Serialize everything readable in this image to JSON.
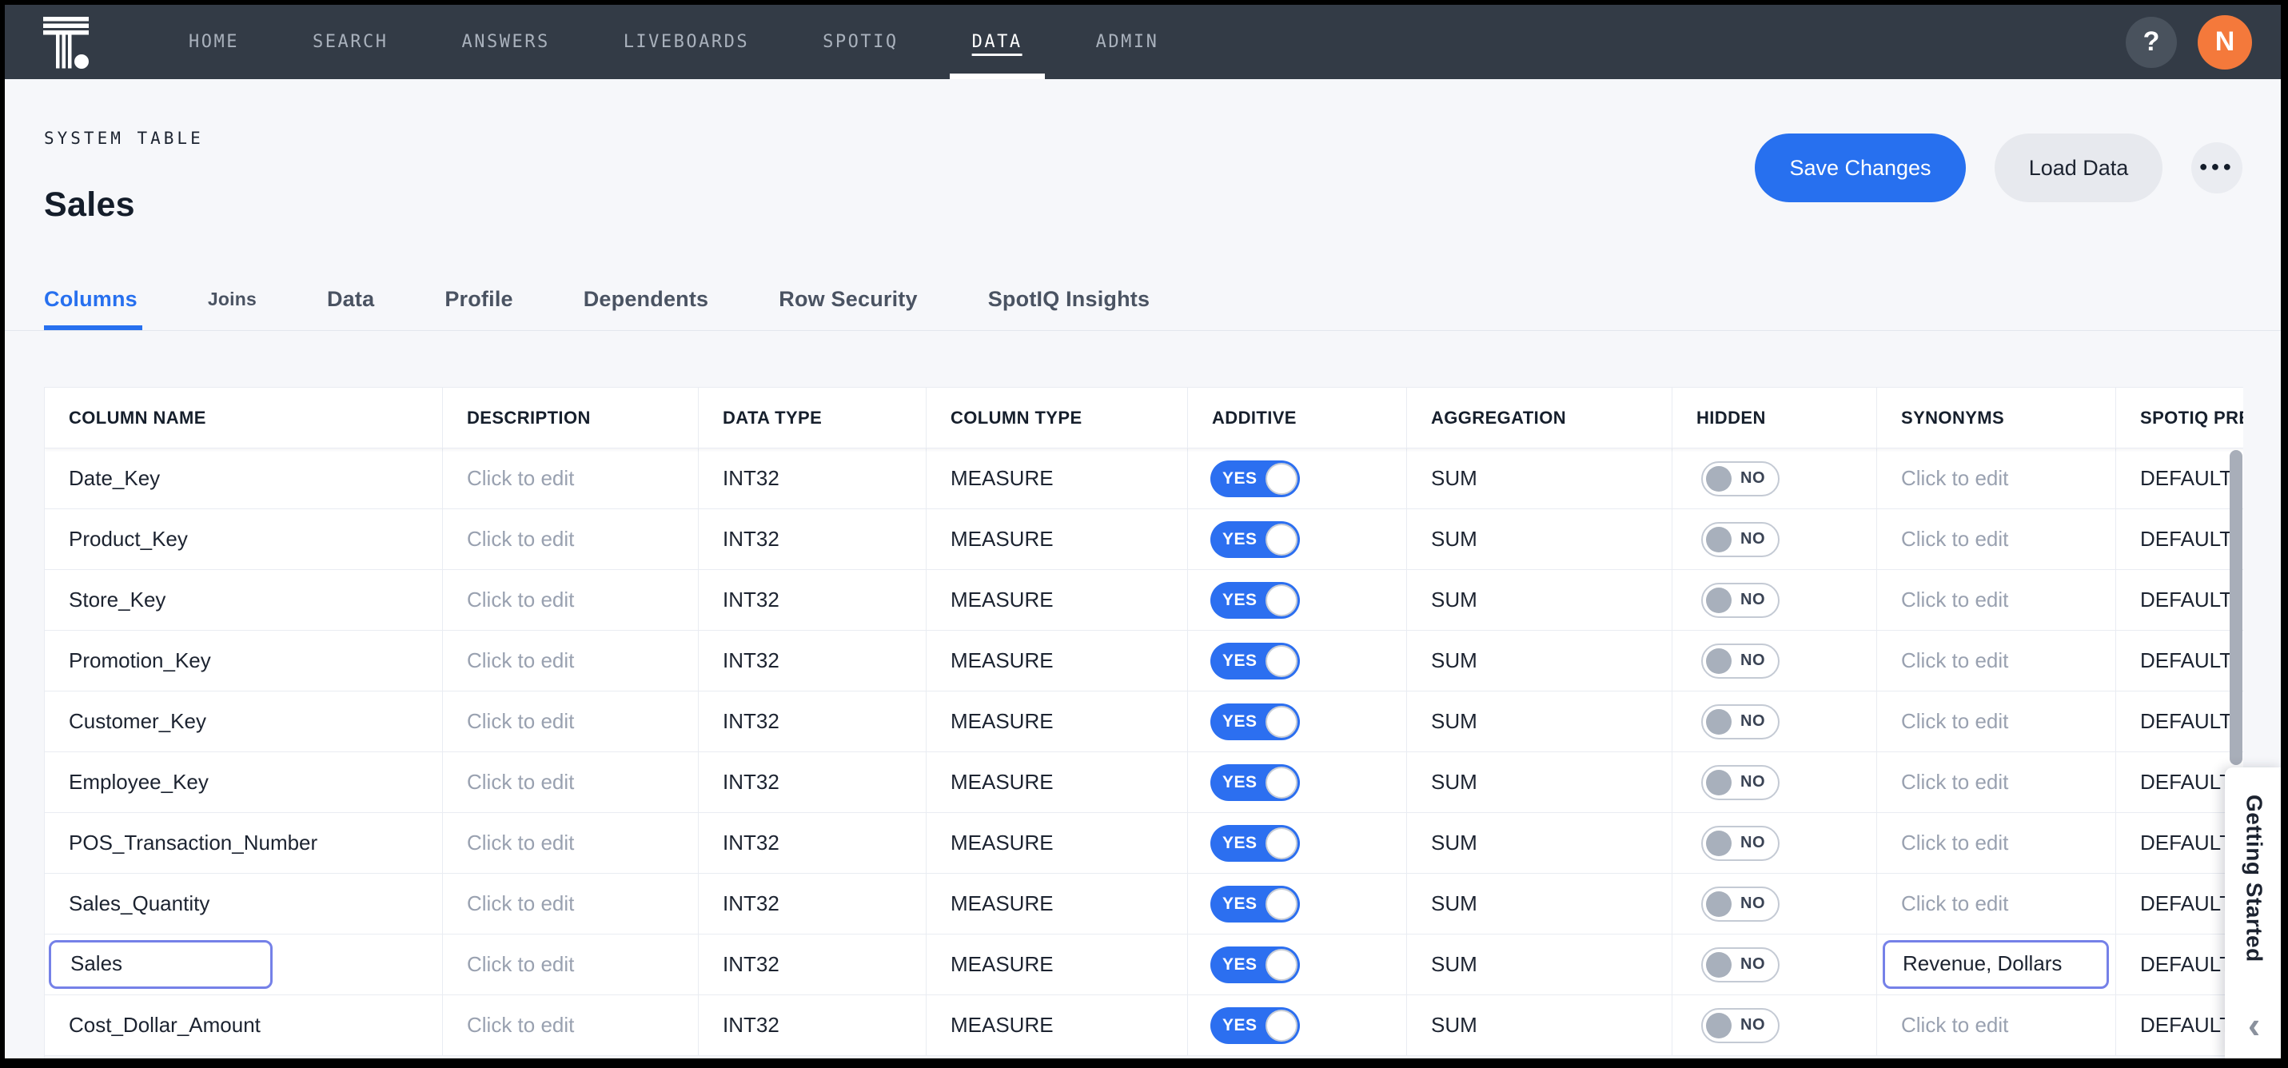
{
  "nav": {
    "items": [
      {
        "label": "HOME",
        "active": false
      },
      {
        "label": "SEARCH",
        "active": false
      },
      {
        "label": "ANSWERS",
        "active": false
      },
      {
        "label": "LIVEBOARDS",
        "active": false
      },
      {
        "label": "SPOTIQ",
        "active": false
      },
      {
        "label": "DATA",
        "active": true
      },
      {
        "label": "ADMIN",
        "active": false
      }
    ],
    "help_label": "?",
    "avatar_initial": "N"
  },
  "header": {
    "eyebrow": "SYSTEM TABLE",
    "title": "Sales",
    "save_label": "Save Changes",
    "load_label": "Load Data",
    "more_label": "●●●"
  },
  "tabs": [
    {
      "label": "Columns",
      "active": true,
      "small": false
    },
    {
      "label": "Joins",
      "active": false,
      "small": true
    },
    {
      "label": "Data",
      "active": false,
      "small": false
    },
    {
      "label": "Profile",
      "active": false,
      "small": false
    },
    {
      "label": "Dependents",
      "active": false,
      "small": false
    },
    {
      "label": "Row Security",
      "active": false,
      "small": false
    },
    {
      "label": "SpotIQ Insights",
      "active": false,
      "small": false
    }
  ],
  "table": {
    "headers": [
      "COLUMN NAME",
      "DESCRIPTION",
      "DATA TYPE",
      "COLUMN TYPE",
      "ADDITIVE",
      "AGGREGATION",
      "HIDDEN",
      "SYNONYMS",
      "SPOTIQ PREFERENCE"
    ],
    "rows": [
      {
        "name": "Date_Key",
        "description": "Click to edit",
        "data_type": "INT32",
        "column_type": "MEASURE",
        "additive": "YES",
        "aggregation": "SUM",
        "hidden": "NO",
        "synonyms": "Click to edit",
        "spotiq_preference": "DEFAULT",
        "name_editing": false,
        "synonyms_editing": false
      },
      {
        "name": "Product_Key",
        "description": "Click to edit",
        "data_type": "INT32",
        "column_type": "MEASURE",
        "additive": "YES",
        "aggregation": "SUM",
        "hidden": "NO",
        "synonyms": "Click to edit",
        "spotiq_preference": "DEFAULT",
        "name_editing": false,
        "synonyms_editing": false
      },
      {
        "name": "Store_Key",
        "description": "Click to edit",
        "data_type": "INT32",
        "column_type": "MEASURE",
        "additive": "YES",
        "aggregation": "SUM",
        "hidden": "NO",
        "synonyms": "Click to edit",
        "spotiq_preference": "DEFAULT",
        "name_editing": false,
        "synonyms_editing": false
      },
      {
        "name": "Promotion_Key",
        "description": "Click to edit",
        "data_type": "INT32",
        "column_type": "MEASURE",
        "additive": "YES",
        "aggregation": "SUM",
        "hidden": "NO",
        "synonyms": "Click to edit",
        "spotiq_preference": "DEFAULT",
        "name_editing": false,
        "synonyms_editing": false
      },
      {
        "name": "Customer_Key",
        "description": "Click to edit",
        "data_type": "INT32",
        "column_type": "MEASURE",
        "additive": "YES",
        "aggregation": "SUM",
        "hidden": "NO",
        "synonyms": "Click to edit",
        "spotiq_preference": "DEFAULT",
        "name_editing": false,
        "synonyms_editing": false
      },
      {
        "name": "Employee_Key",
        "description": "Click to edit",
        "data_type": "INT32",
        "column_type": "MEASURE",
        "additive": "YES",
        "aggregation": "SUM",
        "hidden": "NO",
        "synonyms": "Click to edit",
        "spotiq_preference": "DEFAULT",
        "name_editing": false,
        "synonyms_editing": false
      },
      {
        "name": "POS_Transaction_Number",
        "description": "Click to edit",
        "data_type": "INT32",
        "column_type": "MEASURE",
        "additive": "YES",
        "aggregation": "SUM",
        "hidden": "NO",
        "synonyms": "Click to edit",
        "spotiq_preference": "DEFAULT",
        "name_editing": false,
        "synonyms_editing": false
      },
      {
        "name": "Sales_Quantity",
        "description": "Click to edit",
        "data_type": "INT32",
        "column_type": "MEASURE",
        "additive": "YES",
        "aggregation": "SUM",
        "hidden": "NO",
        "synonyms": "Click to edit",
        "spotiq_preference": "DEFAULT",
        "name_editing": false,
        "synonyms_editing": false
      },
      {
        "name": "Sales",
        "description": "Click to edit",
        "data_type": "INT32",
        "column_type": "MEASURE",
        "additive": "YES",
        "aggregation": "SUM",
        "hidden": "NO",
        "synonyms": "Revenue, Dollars",
        "spotiq_preference": "DEFAULT",
        "name_editing": true,
        "synonyms_editing": true
      },
      {
        "name": "Cost_Dollar_Amount",
        "description": "Click to edit",
        "data_type": "INT32",
        "column_type": "MEASURE",
        "additive": "YES",
        "aggregation": "SUM",
        "hidden": "NO",
        "synonyms": "Click to edit",
        "spotiq_preference": "DEFAULT",
        "name_editing": false,
        "synonyms_editing": false
      }
    ]
  },
  "side_panel": {
    "label": "Getting Started",
    "collapse_icon": "‹"
  },
  "colors": {
    "accent_blue": "#2770EF",
    "toggle_blue": "#2C6FF0",
    "avatar_orange": "#F4793B",
    "navbar_bg": "#333B46",
    "edit_border": "#7581E8",
    "page_bg": "#F6F7FA"
  }
}
